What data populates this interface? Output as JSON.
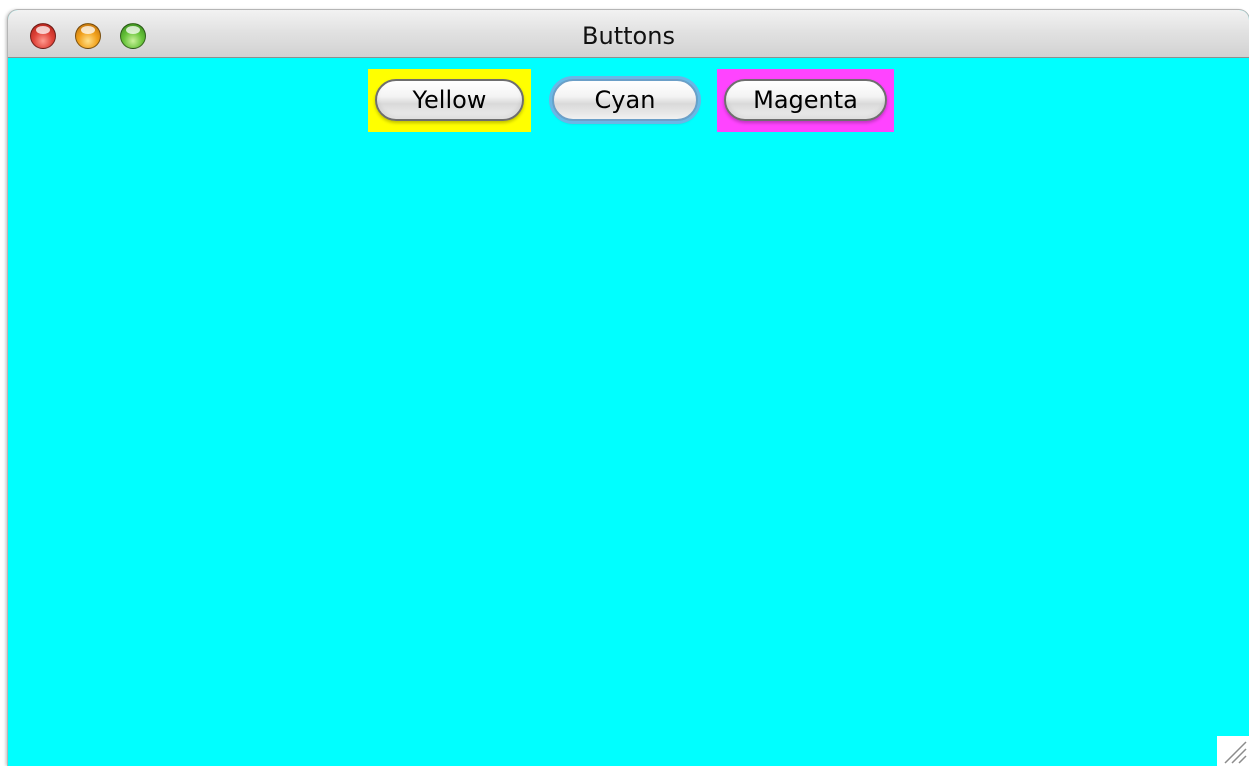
{
  "window": {
    "title": "Buttons",
    "background_color": "#00ffff"
  },
  "buttons": [
    {
      "label": "Yellow",
      "panel_color": "#ffff00"
    },
    {
      "label": "Cyan",
      "panel_color": "#00ffff"
    },
    {
      "label": "Magenta",
      "panel_color": "#ff44ff"
    }
  ],
  "icons": {
    "close": "close-icon",
    "minimize": "minimize-icon",
    "zoom": "zoom-icon",
    "resize": "resize-grip-icon"
  }
}
